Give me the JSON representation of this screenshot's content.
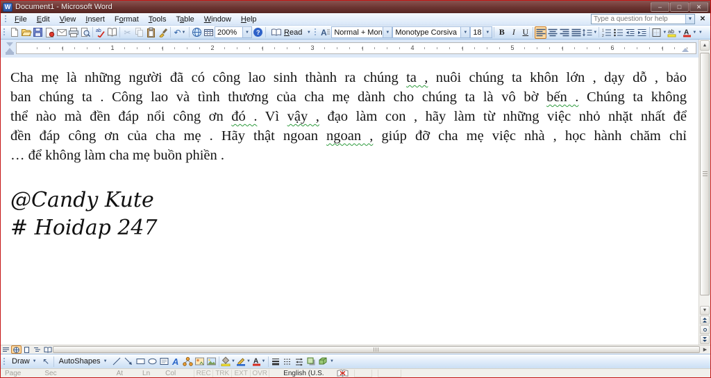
{
  "window": {
    "title": "Document1 - Microsoft Word"
  },
  "menu": {
    "items": [
      {
        "label": "File",
        "u": 0
      },
      {
        "label": "Edit",
        "u": 0
      },
      {
        "label": "View",
        "u": 0
      },
      {
        "label": "Insert",
        "u": 0
      },
      {
        "label": "Format",
        "u": 1
      },
      {
        "label": "Tools",
        "u": 0
      },
      {
        "label": "Table",
        "u": 1
      },
      {
        "label": "Window",
        "u": 0
      },
      {
        "label": "Help",
        "u": 0
      }
    ],
    "question_placeholder": "Type a question for help"
  },
  "standard_toolbar": {
    "icons": [
      "new-document",
      "open",
      "save",
      "permission",
      "email",
      "print",
      "print-preview",
      "spelling-grammar",
      "research",
      "cut",
      "copy",
      "paste",
      "format-painter",
      "undo",
      "insert-hyperlink",
      "insert-table"
    ],
    "zoom_value": "200%",
    "read_button": {
      "label": "Read",
      "u": 0
    }
  },
  "formatting_toolbar": {
    "icons": [
      "styles-and-formatting",
      "bold",
      "italic",
      "underline",
      "align-left",
      "center",
      "align-right",
      "justify",
      "line-spacing",
      "numbering",
      "bullets",
      "decrease-indent",
      "increase-indent",
      "outside-border",
      "highlight",
      "font-color"
    ],
    "style_value": "Normal + Monot",
    "font_value": "Monotype Corsiva",
    "font_size_value": "18",
    "bold_label": "B",
    "italic_label": "I",
    "underline_label": "U",
    "active_alignment": "align-left"
  },
  "ruler": {
    "numbers": [
      "1",
      "2",
      "3",
      "4",
      "5",
      "6"
    ]
  },
  "document": {
    "lines": [
      {
        "justify_last": true,
        "segments": [
          {
            "text": "Cha mẹ là những người đã có công lao sinh thành ra chúng ",
            "squiggle": false
          },
          {
            "text": "ta ,",
            "squiggle": true
          },
          {
            "text": " nuôi chúng ta khôn lớn , dạy dỗ , bảo",
            "squiggle": false
          }
        ]
      },
      {
        "justify_last": true,
        "segments": [
          {
            "text": "ban chúng ta . Công lao và tình thương của cha mẹ dành cho chúng ta là vô bờ ",
            "squiggle": false
          },
          {
            "text": "bến .",
            "squiggle": true
          },
          {
            "text": " Chúng ta không",
            "squiggle": false
          }
        ]
      },
      {
        "justify_last": true,
        "segments": [
          {
            "text": "thể nào mà đền đáp nổi công ơn ",
            "squiggle": false
          },
          {
            "text": "đó .",
            "squiggle": true
          },
          {
            "text": " Vì ",
            "squiggle": false
          },
          {
            "text": "vậy ,",
            "squiggle": true
          },
          {
            "text": " đạo làm con , hãy làm từ những việc nhỏ nhặt nhất để",
            "squiggle": false
          }
        ]
      },
      {
        "justify_last": true,
        "segments": [
          {
            "text": "đền đáp công ơn của cha mẹ . Hãy thật ngoan ",
            "squiggle": false
          },
          {
            "text": "ngoan ,",
            "squiggle": true
          },
          {
            "text": " giúp đỡ cha mẹ việc nhà , học hành chăm chỉ",
            "squiggle": false
          }
        ]
      },
      {
        "justify_last": false,
        "segments": [
          {
            "text": "… để không làm cha mẹ buồn phiền .",
            "squiggle": false
          }
        ]
      }
    ],
    "signature_lines": [
      "@Candy Kute",
      "# Hoidap 247"
    ]
  },
  "view_bar": {
    "buttons": [
      "normal-view",
      "web-layout-view",
      "print-layout-view",
      "outline-view",
      "reading-layout-view"
    ],
    "active": "web-layout-view"
  },
  "drawing_toolbar": {
    "draw_label": "Draw",
    "autoshapes_label": "AutoShapes",
    "icons": [
      "select-objects",
      "line",
      "arrow",
      "rectangle",
      "oval",
      "text-box",
      "insert-wordart",
      "insert-diagram",
      "insert-clip-art",
      "insert-picture",
      "fill-color",
      "line-color",
      "font-color",
      "line-style",
      "dash-style",
      "arrow-style",
      "shadow-style",
      "3d-style"
    ]
  },
  "status_bar": {
    "fields": [
      "Page",
      "Sec",
      "At",
      "Ln",
      "Col"
    ],
    "modes": [
      "REC",
      "TRK",
      "EXT",
      "OVR"
    ],
    "language": "English (U.S.",
    "spelling_icon": "spelling-status-book-icon"
  },
  "colors": {
    "titlebar": "#6b3431",
    "toolbar_blue": "#cbdff4",
    "selection_orange": "#fcd9a2",
    "grammar_squiggle": "#2e9b3d",
    "frame_border": "#c41414"
  }
}
